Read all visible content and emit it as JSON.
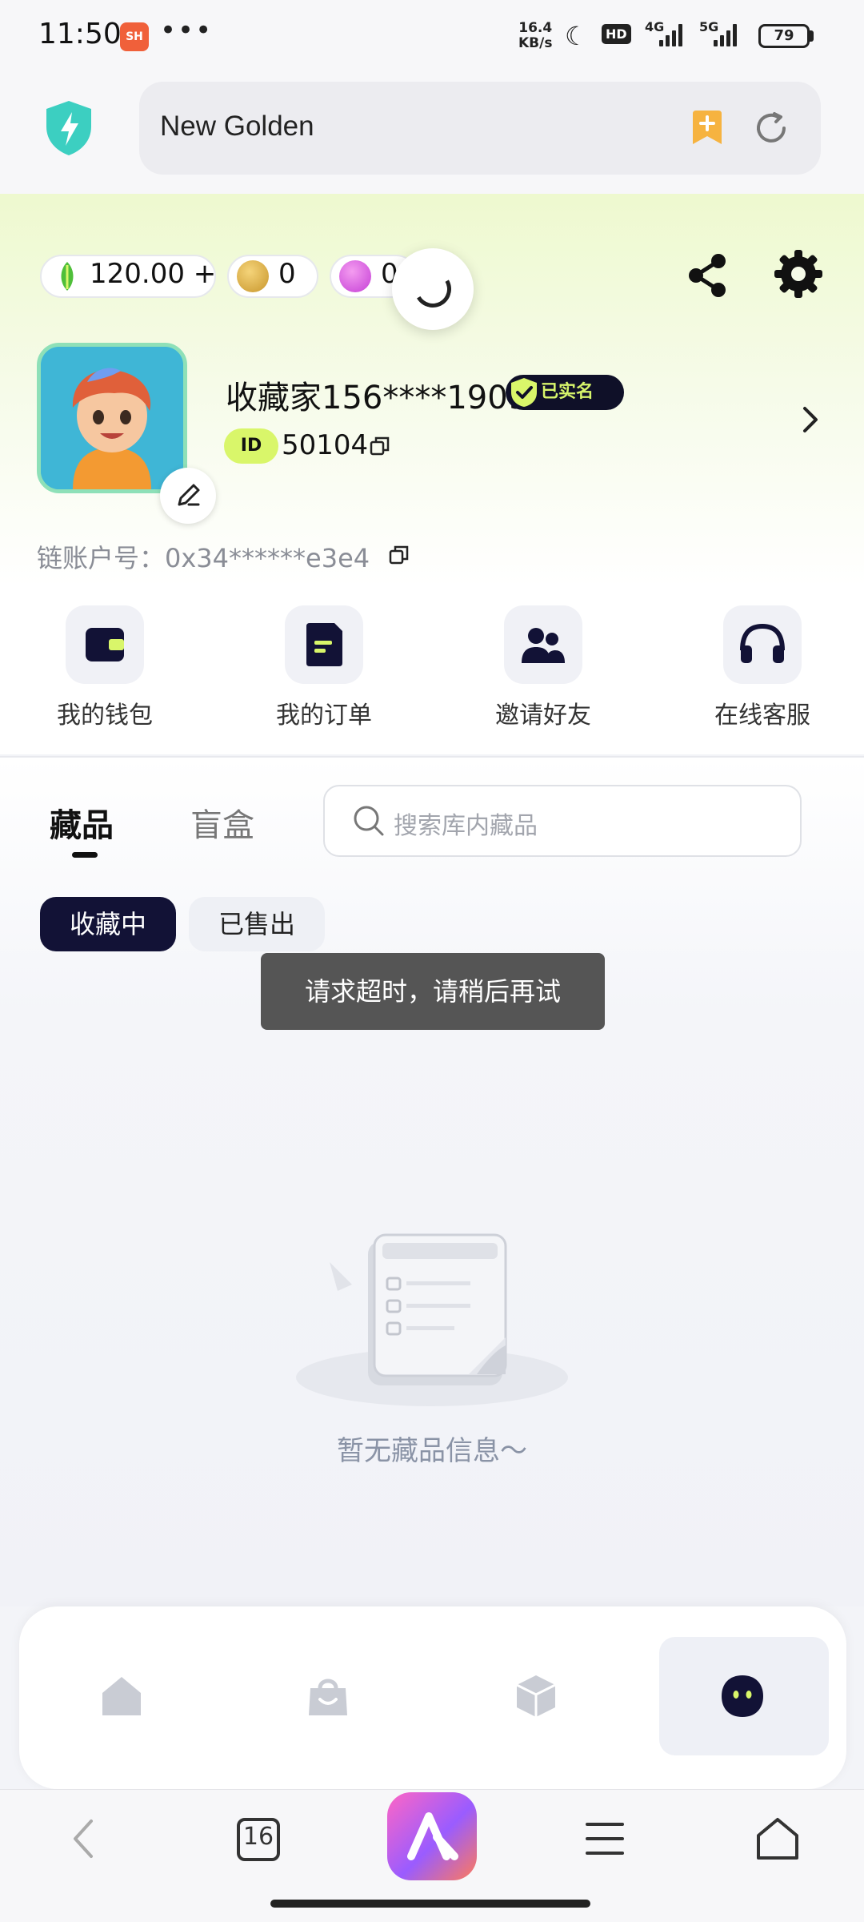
{
  "status_bar": {
    "time": "11:50",
    "app_badge": "SH",
    "more": "•••",
    "speed_value": "16.4",
    "speed_unit": "KB/s",
    "hd": "HD",
    "net1": "4G",
    "net2": "5G",
    "battery": "79"
  },
  "browser": {
    "url_title": "New Golden",
    "tab_count": "16"
  },
  "wallet": {
    "balance": "120.00 +",
    "coins": "0",
    "gems": "0"
  },
  "profile": {
    "username": "收藏家156****1909",
    "verified_label": "已实名",
    "id_label": "ID",
    "id_value": "50104",
    "chain_account": "链账户号：0x34******e3e4"
  },
  "quick_actions": [
    {
      "label": "我的钱包",
      "icon": "wallet-icon"
    },
    {
      "label": "我的订单",
      "icon": "order-icon"
    },
    {
      "label": "邀请好友",
      "icon": "invite-icon"
    },
    {
      "label": "在线客服",
      "icon": "headset-icon"
    }
  ],
  "tabs": {
    "collections": "藏品",
    "blind_box": "盲盒"
  },
  "search": {
    "placeholder": "搜索库内藏品"
  },
  "filters": {
    "collecting": "收藏中",
    "sold": "已售出"
  },
  "toast": "请求超时，请稍后再试",
  "empty_state": "暂无藏品信息～",
  "colors": {
    "accent_lime": "#d9f66a",
    "dark_navy": "#121236",
    "header_gradient": "#eef9cf"
  }
}
